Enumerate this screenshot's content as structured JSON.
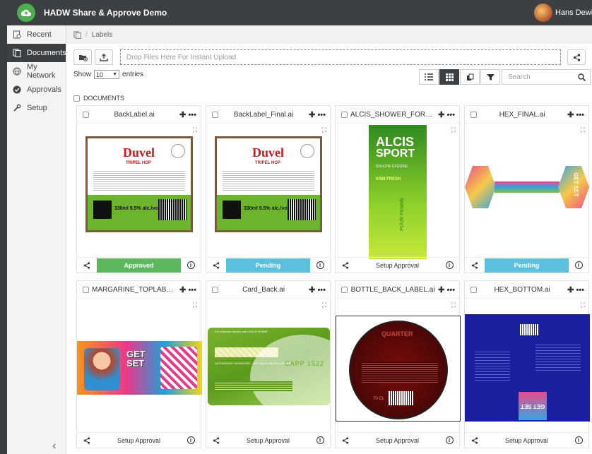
{
  "app": {
    "title": "HADW Share & Approve Demo",
    "user_name": "Hans Dewitte"
  },
  "sidebar": {
    "items": [
      {
        "label": "Recent",
        "icon": "recent-icon"
      },
      {
        "label": "Documents",
        "icon": "documents-icon",
        "active": true
      },
      {
        "label": "My Network",
        "icon": "network-icon"
      },
      {
        "label": "Approvals",
        "icon": "approvals-icon"
      },
      {
        "label": "Setup",
        "icon": "setup-icon"
      }
    ],
    "collapse": "‹"
  },
  "breadcrumb": {
    "sep": "/",
    "current": "Labels"
  },
  "toolbar": {
    "dropzone": "Drop Files Here For Instant Upload"
  },
  "list": {
    "show": "Show",
    "entries_value": "10",
    "entries": "entries",
    "search_placeholder": "Search"
  },
  "section": {
    "label": "DOCUMENTS"
  },
  "cards": [
    {
      "title": "BackLabel.ai",
      "status": "Approved",
      "status_type": "approved"
    },
    {
      "title": "BackLabel_Final.ai",
      "status": "Pending",
      "status_type": "pending"
    },
    {
      "title": "ALCIS_SHOWER_FOR_HE...",
      "status": "Setup Approval",
      "status_type": "setup"
    },
    {
      "title": "HEX_FINAL.ai",
      "status": "Pending",
      "status_type": "pending"
    },
    {
      "title": "MARGARINE_TOPLABEL...",
      "status": "Setup Approval",
      "status_type": "setup"
    },
    {
      "title": "Card_Back.ai",
      "status": "Setup Approval",
      "status_type": "setup"
    },
    {
      "title": "BOTTLE_BACK_LABEL.ai",
      "status": "Setup Approval",
      "status_type": "setup"
    },
    {
      "title": "HEX_BOTTOM.ai",
      "status": "Setup Approval",
      "status_type": "setup"
    }
  ],
  "card_actions": "✚ •••",
  "thumbs": {
    "duvel_brand": "Duvel",
    "duvel_sub": "TRIPEL HOP",
    "duvel_vol": "330ml 9.5% alc./vol.",
    "alcis_brand": "ALCIS",
    "alcis_sport": "SPORT",
    "alcis_sub": "DOUCHE EXQUISE",
    "alcis_kiwi": "KIWI FRESH",
    "alcis_femme": "POUR FEMME",
    "get_set": "GET SET",
    "card_header": "For customer service call (+33) 9710 5687",
    "card_sig": "AUTHORIZED SIGNATURE - NOT VALID UNLESS SIGNED",
    "card_code": "CAPP 1522",
    "bottle_title": "QUARTER",
    "bottle_ml": "70 CL",
    "info_glyph": "i"
  }
}
